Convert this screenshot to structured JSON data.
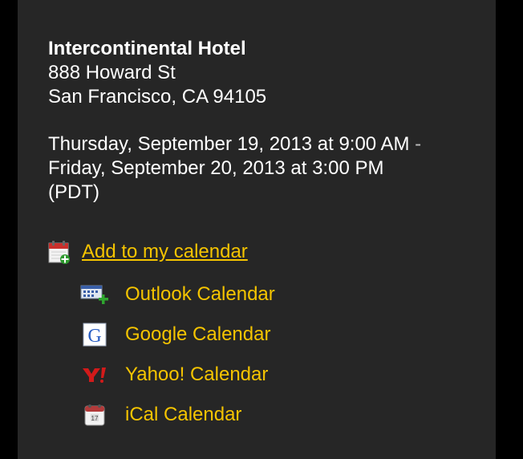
{
  "venue": {
    "name": "Intercontinental Hotel",
    "street": "888 Howard St",
    "city_line": "San Francisco, CA 94105"
  },
  "event": {
    "start": "Thursday, September 19, 2013 at 9:00 AM",
    "separator": "-",
    "end": "Friday, September 20, 2013 at 3:00 PM",
    "timezone": "(PDT)"
  },
  "calendar": {
    "add_label": "Add to my calendar",
    "add_icon": "calendar-add-icon",
    "options": [
      {
        "label": "Outlook Calendar",
        "icon": "outlook-calendar-icon"
      },
      {
        "label": "Google Calendar",
        "icon": "google-icon"
      },
      {
        "label": "Yahoo! Calendar",
        "icon": "yahoo-icon"
      },
      {
        "label": "iCal Calendar",
        "icon": "ical-icon"
      }
    ]
  },
  "colors": {
    "link": "#f5c400",
    "panel_bg": "#262626",
    "page_bg": "#000000",
    "text": "#ffffff"
  }
}
